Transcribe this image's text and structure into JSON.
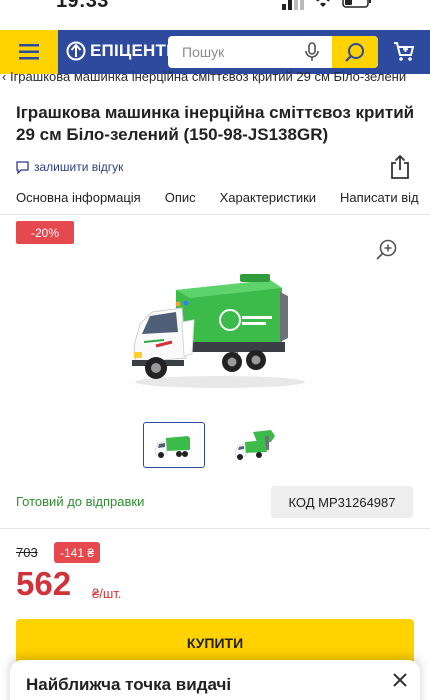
{
  "status_bar": {
    "time": "19:33",
    "icons": [
      "signal-icon",
      "wifi-icon",
      "battery-icon"
    ]
  },
  "header": {
    "logo_text": "ЕПІЦЕНТР",
    "search_placeholder": "Пошук",
    "colors": {
      "header_bg": "#2e4a9e",
      "accent": "#ffd200"
    }
  },
  "breadcrumb": "Іграшкова машинка інерційна сміттєвоз критий 29 см Біло-зелени",
  "product": {
    "title": "Іграшкова машинка інерційна сміттєвоз критий 29 см Біло-зелений (150-98-JS138GR)",
    "review_link": "залишити відгук",
    "tabs": [
      "Основна інформація",
      "Опис",
      "Характеристики",
      "Написати від"
    ],
    "discount_badge": "-20%",
    "stock_status": "Готовий до відправки",
    "code": "КОД MP31264987",
    "thumbnails": [
      "thumbnail-1",
      "thumbnail-2"
    ]
  },
  "price": {
    "old": "703",
    "diff": "-141 ₴",
    "current": "562",
    "unit": "₴/шт.",
    "buy_label": "КУПИТИ",
    "colors": {
      "price": "#d0323a",
      "badge": "#e5484d",
      "stock": "#2f8f2f"
    }
  },
  "sheet": {
    "title": "Найближча точка видачі"
  }
}
